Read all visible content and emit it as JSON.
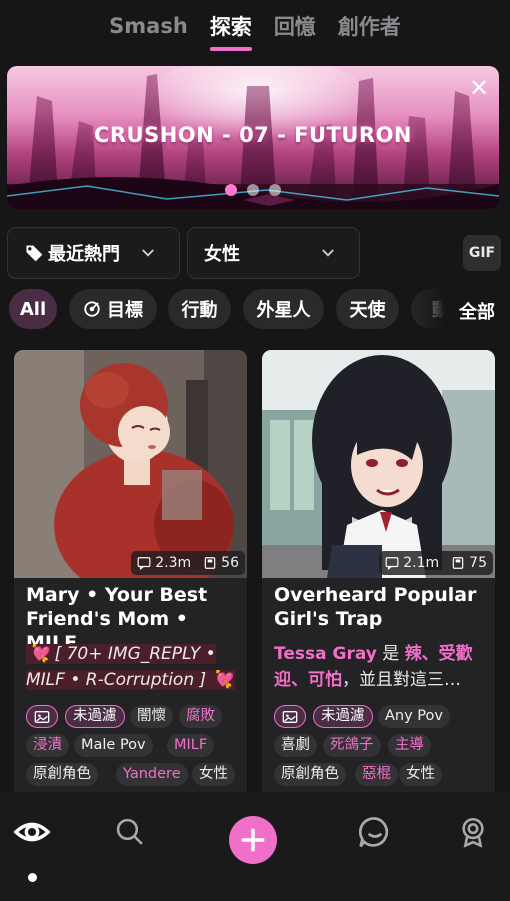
{
  "top_tabs": [
    {
      "label": "Smash"
    },
    {
      "label": "探索"
    },
    {
      "label": "回憶"
    },
    {
      "label": "創作者"
    }
  ],
  "active_tab": "探索",
  "banner": {
    "title": "CRUSHON - 07 - FUTURON",
    "close_icon": "close-icon",
    "dot_count": 3,
    "active_dot": 1
  },
  "filters": {
    "sort_label": "最近熱門",
    "gender_label": "女性",
    "gif_label": "GIF"
  },
  "chips": [
    {
      "label": "All",
      "active": true
    },
    {
      "label": "目標",
      "icon": "target-icon"
    },
    {
      "label": "行動"
    },
    {
      "label": "外星人"
    },
    {
      "label": "天使"
    },
    {
      "label": "動"
    }
  ],
  "all_link": "全部",
  "cards": [
    {
      "views": "2.3m",
      "count": "56",
      "title": "Mary • Your Best Friend's Mom • MILF",
      "desc": "💘 [ 70+ IMG_REPLY • MILF • R-Corruption ] 💘",
      "tags": [
        "未過濾",
        "闇懷",
        "腐敗",
        "浸漬",
        "Male Pov",
        "MILF",
        "原創角色",
        "Yandere",
        "女性"
      ]
    },
    {
      "views": "2.1m",
      "count": "75",
      "title": "Overheard Popular Girl's Trap",
      "desc_highlight": "Tessa Gray",
      "desc_mid": " 是 ",
      "desc_highlight2": "辣、受歡迎、可怕",
      "desc_rest": "，並且對這三…",
      "tags": [
        "未過濾",
        "Any Pov",
        "喜劇",
        "死鴿子",
        "主導",
        "原創角色",
        "惡棍",
        "女性"
      ]
    }
  ],
  "bottom_nav": {
    "items": [
      "eye-icon",
      "search-icon",
      "plus-icon",
      "chat-icon",
      "profile-icon"
    ],
    "accent": "#f06fc8"
  }
}
